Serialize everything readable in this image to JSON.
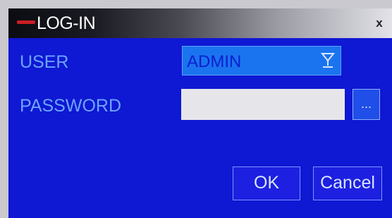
{
  "window": {
    "title": "LOG-IN",
    "close_label": "x"
  },
  "form": {
    "user_label": "USER",
    "user_value": "ADMIN",
    "password_label": "PASSWORD",
    "password_value": "",
    "keyboard_button_label": "..."
  },
  "buttons": {
    "ok_label": "OK",
    "cancel_label": "Cancel"
  },
  "colors": {
    "client_bg": "#0f18d3",
    "label_text": "#6da4ff",
    "select_bg": "#1b74ef",
    "button_bg": "#1d20e0"
  },
  "icons": {
    "dropdown": "dropdown-arrow-icon",
    "logo": "logo-mark-icon"
  }
}
